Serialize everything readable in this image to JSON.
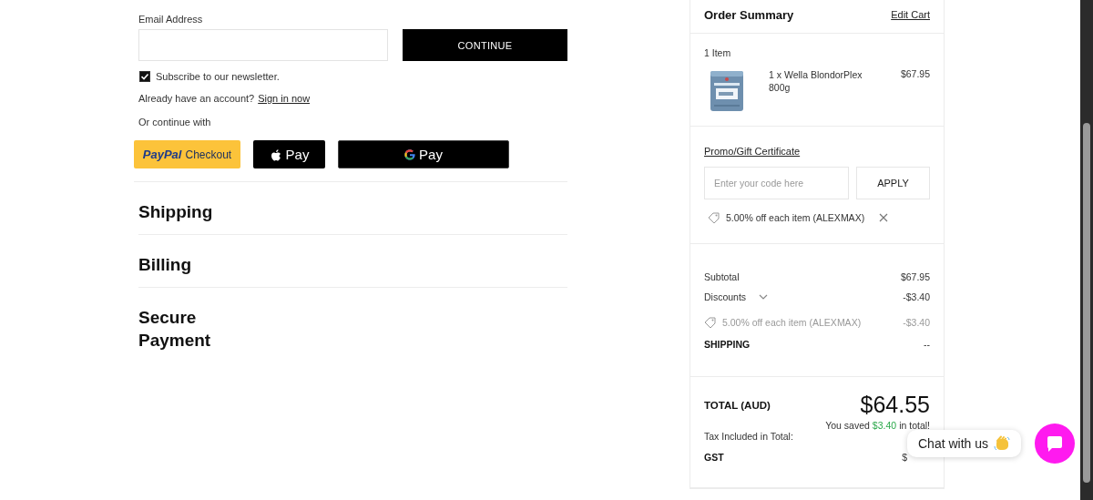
{
  "email": {
    "label": "Email Address",
    "continue": "CONTINUE"
  },
  "newsletter": {
    "label": "Subscribe to our newsletter.",
    "checked": true
  },
  "account": {
    "prompt": "Already have an account?",
    "link": "Sign in now"
  },
  "alt_label": "Or continue with",
  "wallets": [
    {
      "kind": "paypal",
      "brand": "PayPal",
      "label": "Checkout"
    },
    {
      "kind": "apple",
      "label": "Pay"
    },
    {
      "kind": "google",
      "label": "Pay"
    }
  ],
  "sections": [
    "Shipping",
    "Billing",
    "Secure Payment"
  ],
  "summary": {
    "title": "Order Summary",
    "edit_link": "Edit Cart",
    "item_count": "1 Item",
    "items": [
      {
        "name": "1 x Wella BlondorPlex 800g",
        "price": "$67.95",
        "kind": "picture"
      }
    ],
    "promo": {
      "link": "Promo/Gift Certificate",
      "placeholder": "Enter your code here",
      "apply": "APPLY",
      "applied": "5.00% off each item (ALEXMAX)"
    },
    "lines": [
      {
        "kind": "plain",
        "label": "Subtotal",
        "value": "$67.95"
      },
      {
        "kind": "expandable",
        "label": "Discounts",
        "value": "-$3.40",
        "expanded": false
      },
      {
        "kind": "coupon",
        "label": "5.00% off each item (ALEXMAX)",
        "value": "-$3.40"
      },
      {
        "kind": "bold",
        "label": "SHIPPING",
        "value": "--"
      }
    ],
    "total": {
      "label": "TOTAL (AUD)",
      "value": "$64.55",
      "saved_prefix": "You saved",
      "saved_amount": "$3.40",
      "saved_suffix": "in total!"
    },
    "tax_label": "Tax Included in Total:",
    "tax": [
      {
        "label": "GST",
        "value": "$"
      }
    ]
  },
  "chat": {
    "label": "Chat with us"
  }
}
